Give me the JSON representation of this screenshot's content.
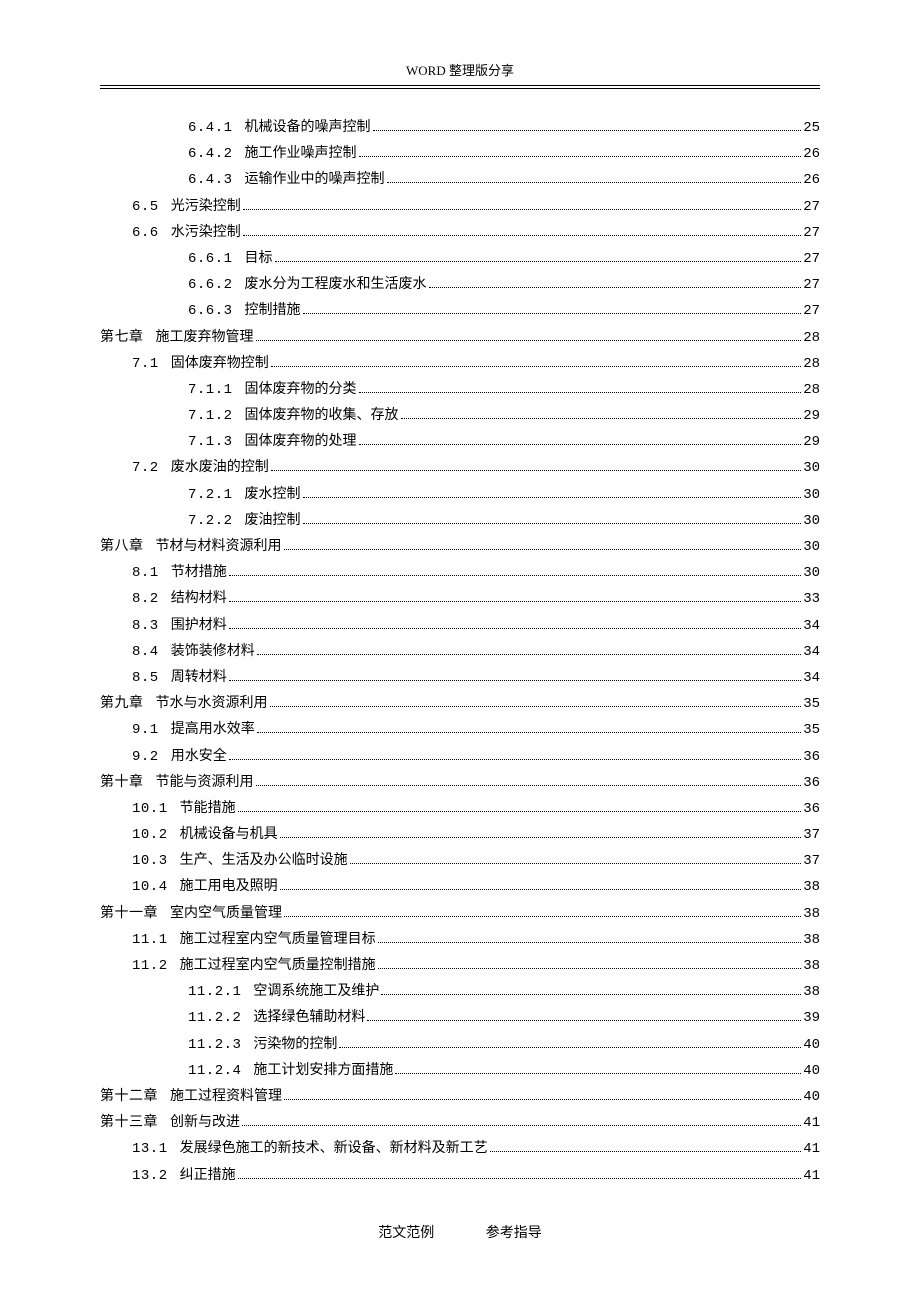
{
  "header": "WORD 整理版分享",
  "footer": {
    "left": "范文范例",
    "right": "参考指导"
  },
  "toc": [
    {
      "level": 3,
      "num": "6.4.1",
      "title": "机械设备的噪声控制",
      "page": "25"
    },
    {
      "level": 3,
      "num": "6.4.2",
      "title": "施工作业噪声控制",
      "page": "26"
    },
    {
      "level": 3,
      "num": "6.4.3",
      "title": "运输作业中的噪声控制",
      "page": "26"
    },
    {
      "level": 2,
      "num": "6.5",
      "title": "光污染控制",
      "page": "27"
    },
    {
      "level": 2,
      "num": "6.6",
      "title": "水污染控制",
      "page": "27"
    },
    {
      "level": 3,
      "num": "6.6.1",
      "title": "目标",
      "page": "27"
    },
    {
      "level": 3,
      "num": "6.6.2",
      "title": "废水分为工程废水和生活废水",
      "page": "27"
    },
    {
      "level": 3,
      "num": "6.6.3",
      "title": "控制措施",
      "page": "27"
    },
    {
      "level": 1,
      "num": "第七章",
      "title": "施工废弃物管理",
      "page": "28"
    },
    {
      "level": 2,
      "num": "7.1",
      "title": "固体废弃物控制",
      "page": "28"
    },
    {
      "level": 3,
      "num": "7.1.1",
      "title": "固体废弃物的分类",
      "page": "28"
    },
    {
      "level": 3,
      "num": "7.1.2",
      "title": "固体废弃物的收集、存放",
      "page": "29"
    },
    {
      "level": 3,
      "num": "7.1.3",
      "title": "固体废弃物的处理",
      "page": "29"
    },
    {
      "level": 2,
      "num": "7.2",
      "title": "废水废油的控制",
      "page": "30"
    },
    {
      "level": 3,
      "num": "7.2.1",
      "title": "废水控制",
      "page": "30"
    },
    {
      "level": 3,
      "num": "7.2.2",
      "title": "废油控制",
      "page": "30"
    },
    {
      "level": 1,
      "num": "第八章",
      "title": "节材与材料资源利用",
      "page": "30"
    },
    {
      "level": 2,
      "num": "8.1",
      "title": "节材措施",
      "page": "30"
    },
    {
      "level": 2,
      "num": "8.2",
      "title": "结构材料",
      "page": "33"
    },
    {
      "level": 2,
      "num": "8.3",
      "title": "围护材料",
      "page": "34"
    },
    {
      "level": 2,
      "num": "8.4",
      "title": "装饰装修材料",
      "page": "34"
    },
    {
      "level": 2,
      "num": "8.5",
      "title": "周转材料",
      "page": "34"
    },
    {
      "level": 1,
      "num": "第九章",
      "title": "节水与水资源利用",
      "page": "35"
    },
    {
      "level": 2,
      "num": "9.1",
      "title": "提高用水效率",
      "page": "35"
    },
    {
      "level": 2,
      "num": "9.2",
      "title": "用水安全",
      "page": "36"
    },
    {
      "level": 1,
      "num": "第十章",
      "title": "节能与资源利用",
      "page": "36"
    },
    {
      "level": 2,
      "num": "10.1",
      "title": "节能措施",
      "page": "36"
    },
    {
      "level": 2,
      "num": "10.2",
      "title": "机械设备与机具",
      "page": "37"
    },
    {
      "level": 2,
      "num": "10.3",
      "title": "生产、生活及办公临时设施",
      "page": "37"
    },
    {
      "level": 2,
      "num": "10.4",
      "title": "施工用电及照明",
      "page": "38"
    },
    {
      "level": 1,
      "num": "第十一章",
      "title": "室内空气质量管理",
      "page": "38"
    },
    {
      "level": 2,
      "num": "11.1",
      "title": "施工过程室内空气质量管理目标",
      "page": "38"
    },
    {
      "level": 2,
      "num": "11.2",
      "title": "施工过程室内空气质量控制措施",
      "page": "38"
    },
    {
      "level": 3,
      "num": "11.2.1",
      "title": "空调系统施工及维护",
      "page": "38"
    },
    {
      "level": 3,
      "num": "11.2.2",
      "title": "选择绿色辅助材料",
      "page": "39"
    },
    {
      "level": 3,
      "num": "11.2.3",
      "title": "污染物的控制",
      "page": "40"
    },
    {
      "level": 3,
      "num": "11.2.4",
      "title": "施工计划安排方面措施",
      "page": "40"
    },
    {
      "level": 1,
      "num": "第十二章",
      "title": "施工过程资料管理",
      "page": "40"
    },
    {
      "level": 1,
      "num": "第十三章",
      "title": "创新与改进",
      "page": "41"
    },
    {
      "level": 2,
      "num": "13.1",
      "title": "发展绿色施工的新技术、新设备、新材料及新工艺",
      "page": "41"
    },
    {
      "level": 2,
      "num": "13.2",
      "title": "纠正措施",
      "page": "41"
    }
  ]
}
